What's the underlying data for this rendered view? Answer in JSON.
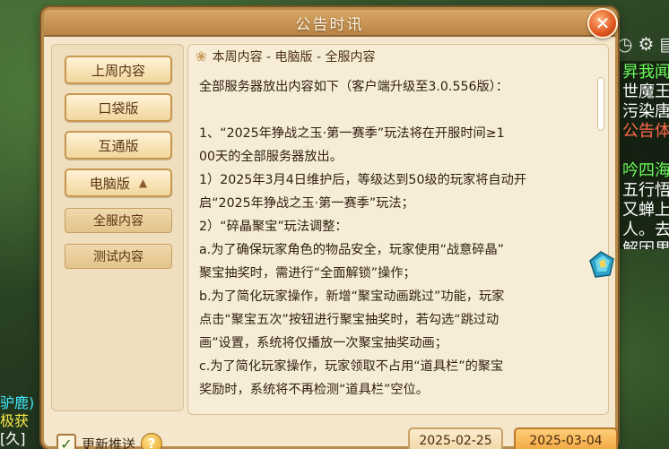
{
  "window": {
    "title": "公告时讯"
  },
  "sidebar": {
    "buttons": [
      {
        "label": "上周内容"
      },
      {
        "label": "口袋版"
      },
      {
        "label": "互通版"
      },
      {
        "label": "电脑版",
        "expanded": true
      }
    ],
    "sub_items": [
      {
        "label": "全服内容"
      },
      {
        "label": "测试内容"
      }
    ]
  },
  "content": {
    "header": "本周内容 - 电脑版 - 全服内容",
    "lines": [
      "全部服务器放出内容如下（客户端升级至3.0.556版）：",
      "",
      "1、“2025年狰战之玉·第一赛季”玩法将在开服时间≥1",
      "00天的全部服务器放出。",
      "1）2025年3月4日维护后，等级达到50级的玩家将自动开",
      "启“2025年狰战之玉·第一赛季”玩法；",
      "2）“碎晶聚宝”玩法调整：",
      "a.为了确保玩家角色的物品安全，玩家使用“战意碎晶”",
      "聚宝抽奖时，需进行“全面解锁”操作；",
      "b.为了简化玩家操作，新增“聚宝动画跳过”功能，玩家",
      "点击“聚宝五次”按钮进行聚宝抽奖时，若勾选“跳过动",
      "画”设置，系统将仅播放一次聚宝抽奖动画；",
      "c.为了简化玩家操作，玩家领取不占用“道具栏”的聚宝",
      "奖励时，系统将不再检测“道具栏”空位。"
    ]
  },
  "footer": {
    "push_label": "更新推送",
    "push_checked": true,
    "dates": [
      "2025-02-25",
      "2025-03-04"
    ],
    "active_date": "2025-03-04"
  },
  "background": {
    "left_chat": [
      {
        "text": "驴鹿)",
        "color": "#3fe8ff"
      },
      {
        "text": "极获",
        "color": "#f5e94a"
      },
      {
        "text": "[久]",
        "color": "#ffffff"
      }
    ],
    "right_chat": [
      {
        "text": "昇我闻",
        "color": "#6dff5a"
      },
      {
        "text": "世魔王",
        "color": "#ffffff"
      },
      {
        "text": "污染唐",
        "color": "#ffffff"
      },
      {
        "text": "公告体",
        "color": "#ff6a4a"
      },
      {
        "text": "",
        "color": "#ffffff"
      },
      {
        "text": "吟四海",
        "color": "#6dff5a"
      },
      {
        "text": "五行悟",
        "color": "#ffffff"
      },
      {
        "text": "又蝉上",
        "color": "#ffffff"
      },
      {
        "text": "人。去",
        "color": "#ffffff"
      },
      {
        "text": "解因果",
        "color": "#ffffff"
      }
    ]
  },
  "icons": {
    "close": "close-icon",
    "settings": "gear-icon",
    "help": "help-icon",
    "gem": "gem-icon"
  }
}
